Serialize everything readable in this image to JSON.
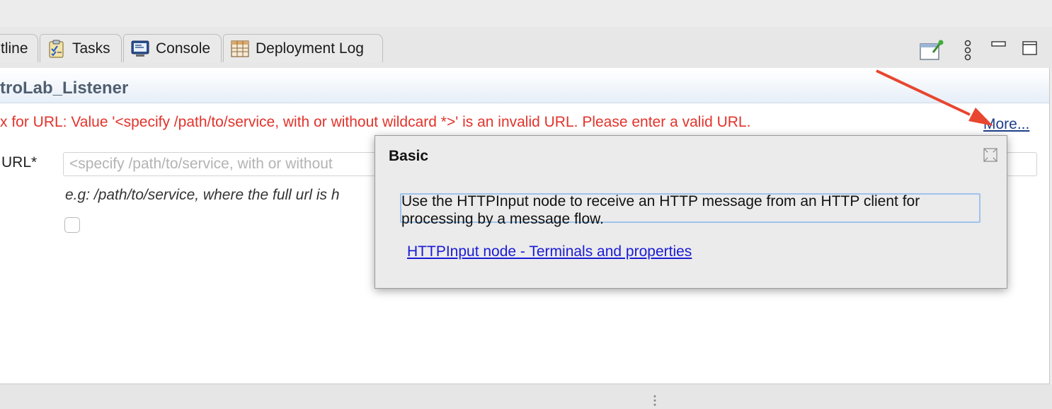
{
  "tabs": [
    {
      "label": "tline",
      "icon": "outline-icon"
    },
    {
      "label": "Tasks",
      "icon": "tasks-icon"
    },
    {
      "label": "Console",
      "icon": "console-icon"
    },
    {
      "label": "Deployment Log",
      "icon": "table-icon"
    }
  ],
  "toolbar": {
    "icons": [
      "new-window-pin-icon",
      "view-menu-icon",
      "minimize-icon",
      "maximize-icon"
    ]
  },
  "editor": {
    "title": "troLab_Listener",
    "error": "x for URL: Value '<specify /path/to/service, with or without wildcard *>' is an invalid URL. Please enter a valid URL.",
    "more_link": "More...",
    "url_label": "URL*",
    "url_placeholder": "<specify /path/to/service, with or without",
    "hint": "e.g: /path/to/service, where the full url is h"
  },
  "popup": {
    "title": "Basic",
    "description": "Use the HTTPInput node to receive an HTTP message from an HTTP client for processing by a message flow.",
    "link": "HTTPInput node - Terminals and properties"
  },
  "colors": {
    "error": "#e2332b",
    "annotation_arrow": "#e8462f",
    "link": "#1a1ad6",
    "header_title": "#4f5f70"
  }
}
